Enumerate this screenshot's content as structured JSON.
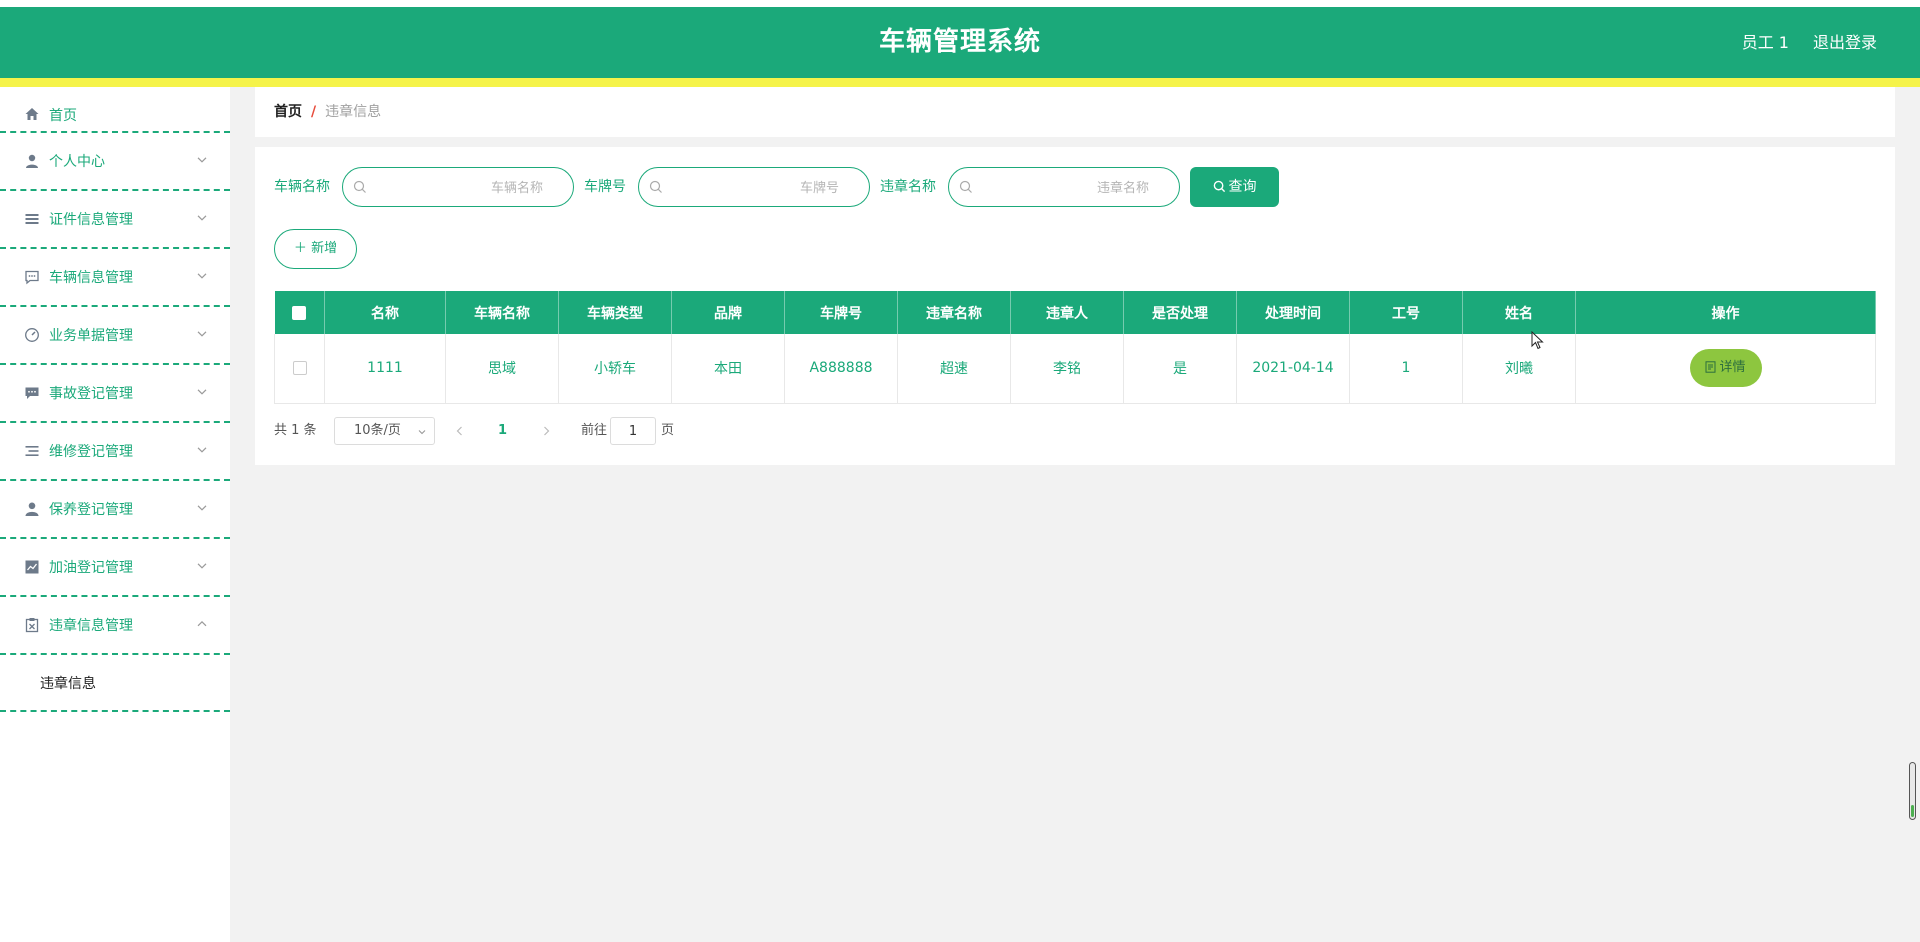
{
  "header": {
    "title": "车辆管理系统",
    "user": "员工 1",
    "logout": "退出登录"
  },
  "sidebar": {
    "items": [
      {
        "label": "首页",
        "icon": "home-icon"
      },
      {
        "label": "个人中心",
        "icon": "user-icon"
      },
      {
        "label": "证件信息管理",
        "icon": "menu-icon"
      },
      {
        "label": "车辆信息管理",
        "icon": "chat-icon"
      },
      {
        "label": "业务单据管理",
        "icon": "gauge-icon"
      },
      {
        "label": "事故登记管理",
        "icon": "message-icon"
      },
      {
        "label": "维修登记管理",
        "icon": "list-icon"
      },
      {
        "label": "保养登记管理",
        "icon": "person-icon"
      },
      {
        "label": "加油登记管理",
        "icon": "chart-icon"
      },
      {
        "label": "违章信息管理",
        "icon": "clipboard-icon"
      }
    ],
    "sub_item": "违章信息"
  },
  "breadcrumb": {
    "home": "首页",
    "sep": "/",
    "current": "违章信息"
  },
  "search": {
    "vehicle_name_label": "车辆名称",
    "vehicle_name_placeholder": "车辆名称",
    "plate_label": "车牌号",
    "plate_placeholder": "车牌号",
    "violation_label": "违章名称",
    "violation_placeholder": "违章名称",
    "query_label": "查询"
  },
  "add_label": "新增",
  "table": {
    "columns": [
      "名称",
      "车辆名称",
      "车辆类型",
      "品牌",
      "车牌号",
      "违章名称",
      "违章人",
      "是否处理",
      "处理时间",
      "工号",
      "姓名",
      "操作"
    ],
    "rows": [
      {
        "name": "1111",
        "vehicle_name": "思域",
        "vehicle_type": "小轿车",
        "brand": "本田",
        "plate": "A888888",
        "violation": "超速",
        "violator": "李铭",
        "handled": "是",
        "handle_time": "2021-04-14",
        "job_no": "1",
        "person": "刘曦",
        "action": "详情"
      }
    ]
  },
  "pagination": {
    "total": "共 1 条",
    "page_size": "10条/页",
    "current_page": "1",
    "goto_label": "前往",
    "goto_value": "1",
    "page_unit": "页"
  },
  "colors": {
    "primary": "#1ba97a",
    "stripe": "#f5f34a",
    "detail_button": "#8dc63f"
  }
}
